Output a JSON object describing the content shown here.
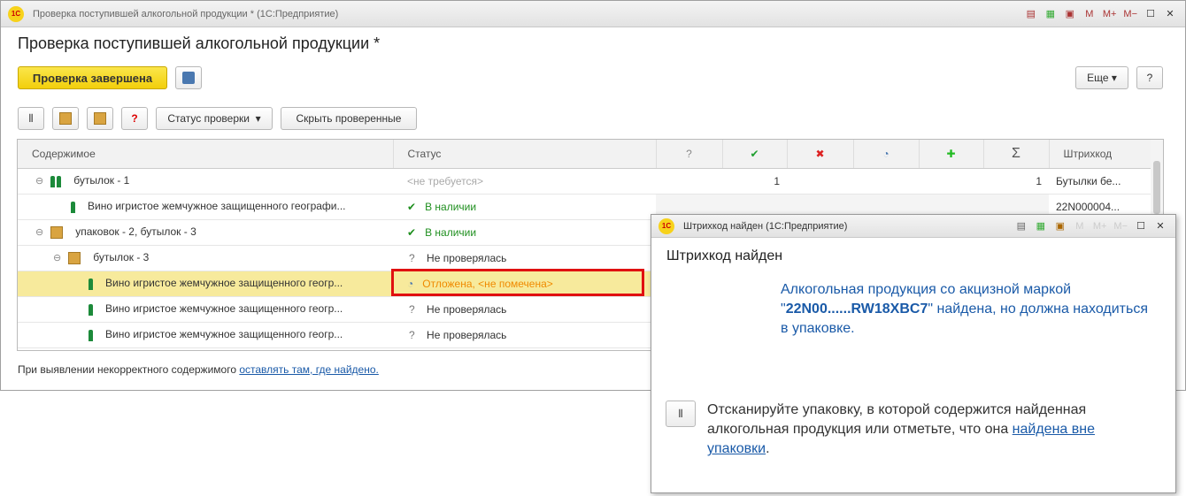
{
  "window": {
    "title": "Проверка поступившей алкогольной продукции *  (1С:Предприятие)",
    "heading": "Проверка поступившей алкогольной продукции *",
    "tb": [
      "M",
      "M+",
      "M−"
    ]
  },
  "toolbar": {
    "finish": "Проверка завершена",
    "status_check": "Статус проверки",
    "hide_checked": "Скрыть проверенные",
    "more": "Еще",
    "help": "?"
  },
  "table": {
    "headers": {
      "content": "Содержимое",
      "status": "Статус",
      "q": "?",
      "ok": "✔",
      "bad": "✖",
      "postponed": "◔",
      "added": "✚",
      "sum": "Σ",
      "barcode": "Штрихкод"
    },
    "rows": [
      {
        "content": "бутылок -  1",
        "status": "<не требуется>",
        "ok": "1",
        "sum": "1",
        "barcode": "Бутылки бе..."
      },
      {
        "content": "Вино игристое жемчужное защищенного географи...",
        "status": "В наличии",
        "barcode": "22N000004..."
      },
      {
        "content": "упаковок - 2, бутылок -  3",
        "status": "В наличии"
      },
      {
        "content": "бутылок -  3",
        "status": "Не проверялась"
      },
      {
        "content": "Вино игристое жемчужное защищенного геогр...",
        "status": "Отложена, <не помечена>"
      },
      {
        "content": "Вино игристое жемчужное защищенного геогр...",
        "status": "Не проверялась"
      },
      {
        "content": "Вино игристое жемчужное защищенного геогр...",
        "status": "Не проверялась"
      }
    ]
  },
  "footer": {
    "text": "При выявлении некорректного содержимого ",
    "link": "оставлять там, где найдено."
  },
  "dialog": {
    "title": "Штрихкод найден  (1С:Предприятие)",
    "heading": "Штрихкод найден",
    "msg1": "Алкогольная продукция со акцизной маркой \"",
    "code": "22N00......RW18XBC7",
    "msg2": "\" найдена, но должна находиться в упаковке.",
    "hint": "Отсканируйте упаковку, в которой содержится найденная алкогольная продукция или отметьте, что она ",
    "hint_link": "найдена вне упаковки",
    "hint_end": "."
  },
  "colors": {
    "accent": "#f2cf0b",
    "link": "#1a5aa8",
    "ok": "#1f8f1f",
    "postponed": "#f08a00",
    "highlight": "#e01010"
  }
}
